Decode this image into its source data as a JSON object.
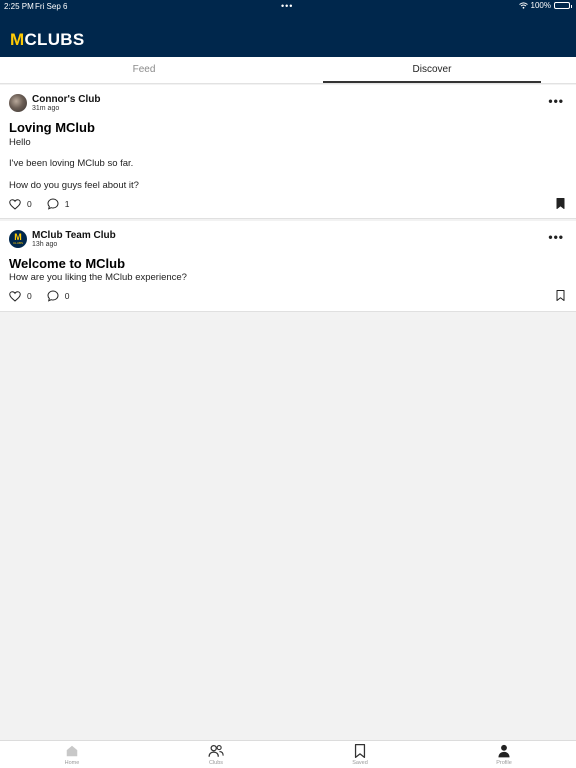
{
  "status_bar": {
    "time": "2:25 PM",
    "date": "Fri Sep 6",
    "dots": "•••",
    "battery": "100%"
  },
  "header": {
    "logo_m": "M",
    "logo_rest": "CLUBS"
  },
  "tabs": [
    {
      "label": "Feed",
      "active": false
    },
    {
      "label": "Discover",
      "active": true
    }
  ],
  "posts": [
    {
      "club": "Connor's Club",
      "time_ago": "31m ago",
      "title": "Loving MClub",
      "body": [
        "Hello",
        "I've been loving MClub so far.",
        "How do you guys feel about it?"
      ],
      "likes": "0",
      "comments": "1",
      "saved": true
    },
    {
      "club": "MClub Team Club",
      "time_ago": "13h ago",
      "title": "Welcome to MClub",
      "body": [
        "How are you liking the MClub experience?"
      ],
      "likes": "0",
      "comments": "0",
      "saved": false
    }
  ],
  "avatar_m": {
    "letter": "M",
    "sub": "CLUBS"
  },
  "bottom_nav": [
    {
      "label": "Home",
      "icon": "home-icon"
    },
    {
      "label": "Clubs",
      "icon": "people-icon"
    },
    {
      "label": "Saved",
      "icon": "bookmark-icon"
    },
    {
      "label": "Profile",
      "icon": "person-icon"
    }
  ],
  "colors": {
    "header_bg": "#00274c",
    "brand_yellow": "#ffcb05"
  }
}
